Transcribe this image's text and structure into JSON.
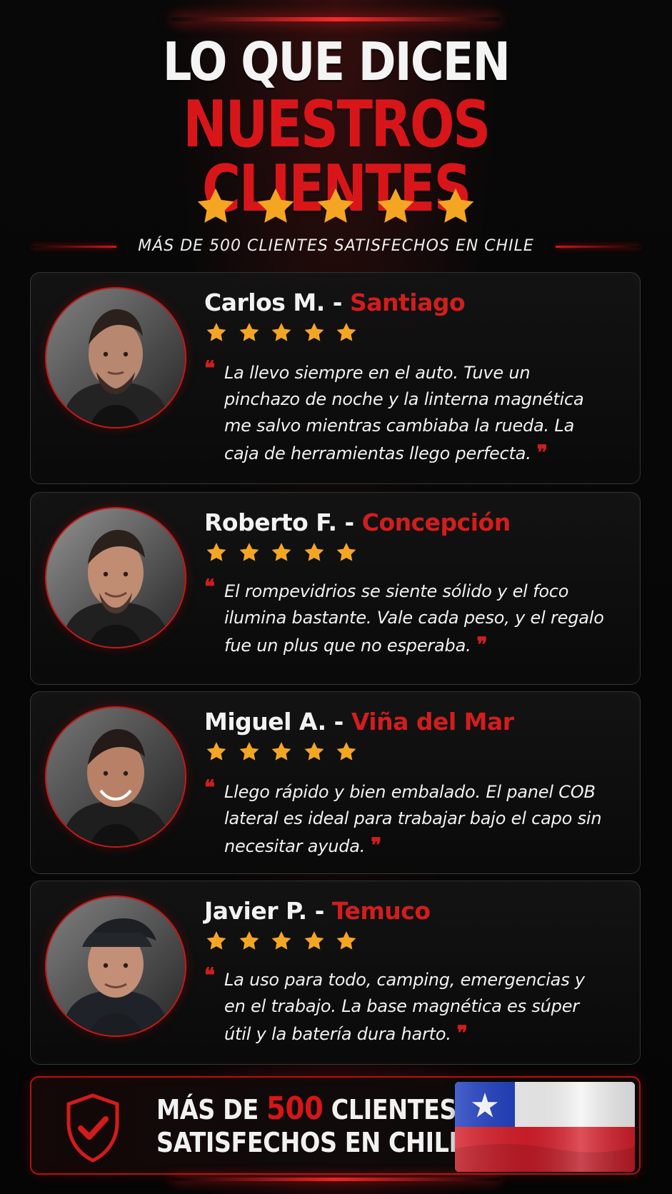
{
  "page": {
    "title_line_1": "LO QUE DICEN",
    "title_line_2": "NUESTROS CLIENTES",
    "subtitle": "MÁS DE 500 CLIENTES SATISFECHOS EN CHILE",
    "hero_rating": 5,
    "colors": {
      "background": "#060606",
      "accent_red": "#d31d1d",
      "star_gold": "#f4a623",
      "text_white": "#f2f2f2"
    }
  },
  "reviews": [
    {
      "name": "Carlos M.",
      "separator": "-",
      "city": "Santiago",
      "rating": 5,
      "avatar_icon": "avatar-photo",
      "quote": "La llevo siempre en el auto. Tuve un pinchazo de noche y la linterna magnética me salvo mientras cambiaba la rueda. La caja de herramientas llego perfecta.",
      "quote_open": "❝",
      "quote_close": "❞"
    },
    {
      "name": "Roberto F.",
      "separator": "-",
      "city": "Concepción",
      "rating": 5,
      "avatar_icon": "avatar-photo",
      "quote": "El rompevidrios se siente sólido y el foco ilumina bastante. Vale cada peso, y el regalo fue un plus que no esperaba.",
      "quote_open": "❝",
      "quote_close": "❞"
    },
    {
      "name": "Miguel A.",
      "separator": "-",
      "city": "Viña del Mar",
      "rating": 5,
      "avatar_icon": "avatar-photo",
      "quote": "Llego rápido y bien embalado. El panel COB lateral es ideal para trabajar bajo el capo sin necesitar ayuda.",
      "quote_open": "❝",
      "quote_close": "❞"
    },
    {
      "name": "Javier P.",
      "separator": "-",
      "city": "Temuco",
      "rating": 5,
      "avatar_icon": "avatar-photo",
      "quote": "La uso para todo, camping, emergencias y en el trabajo. La base magnética es súper útil y la batería dura harto.",
      "quote_open": "❝",
      "quote_close": "❞"
    }
  ],
  "footer": {
    "line_1_prefix": "MÁS DE",
    "line_1_number": "500",
    "line_1_suffix": "CLIENTES",
    "line_2": "SATISFECHOS EN CHILE",
    "shield_icon": "shield-check-icon",
    "flag_icon": "chile-flag-icon"
  }
}
